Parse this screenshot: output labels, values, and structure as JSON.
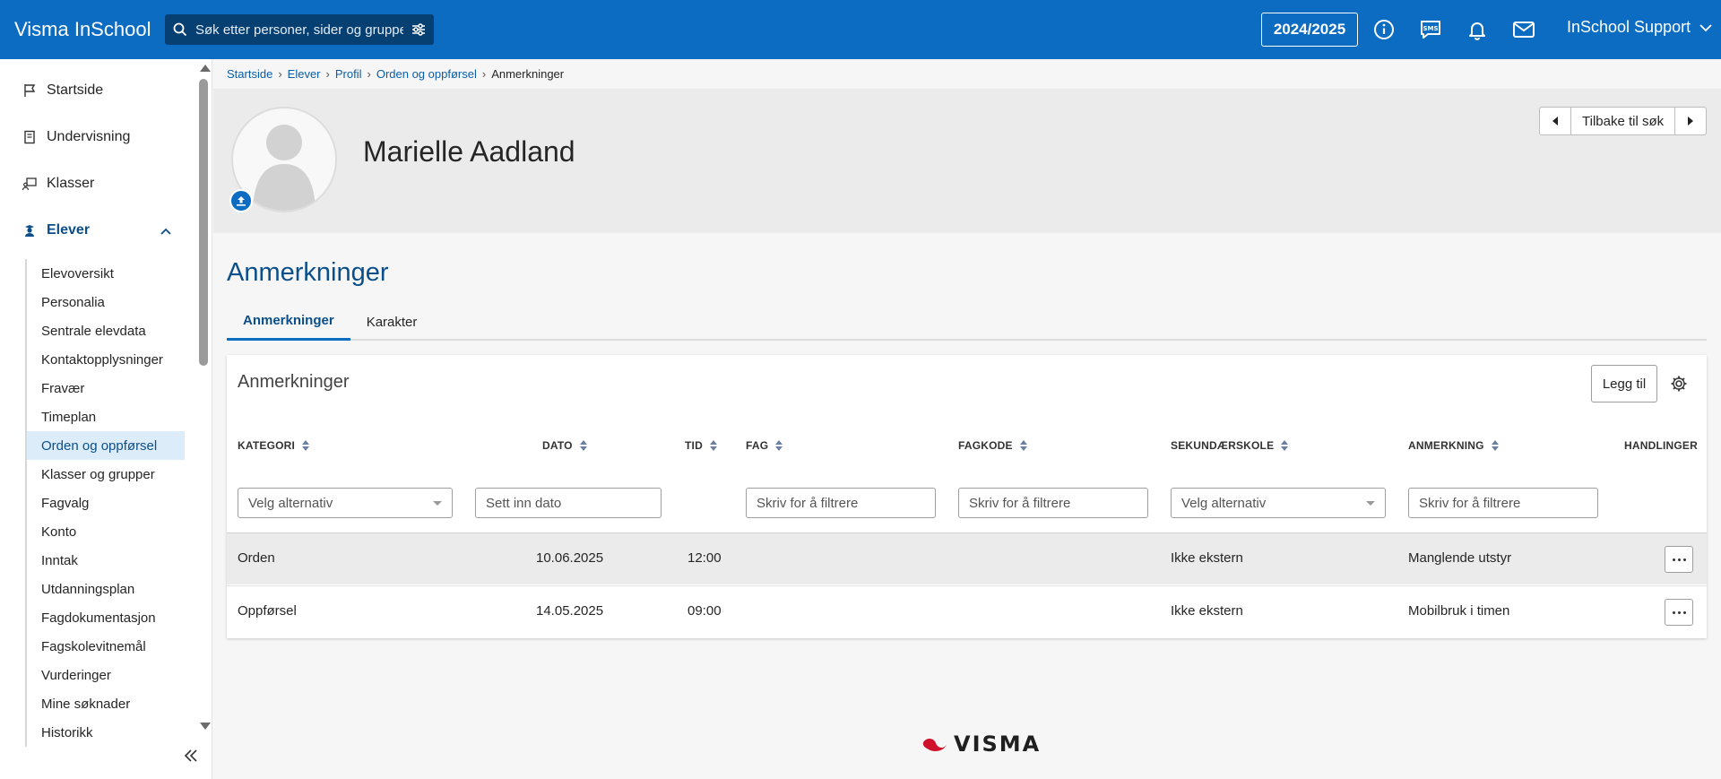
{
  "header": {
    "brand": "Visma InSchool",
    "search_placeholder": "Søk etter personer, sider og grupper",
    "year": "2024/2025",
    "user": "InSchool Support",
    "colors": {
      "bar": "#0b6cc2",
      "search_bg": "#063f72"
    }
  },
  "sidebar": {
    "top_items": [
      {
        "label": "Startside",
        "icon": "flag-icon"
      },
      {
        "label": "Undervisning",
        "icon": "book-icon"
      },
      {
        "label": "Klasser",
        "icon": "classroom-icon"
      },
      {
        "label": "Elever",
        "icon": "student-icon"
      }
    ],
    "sub_items": [
      "Elevoversikt",
      "Personalia",
      "Sentrale elevdata",
      "Kontaktopplysninger",
      "Fravær",
      "Timeplan",
      "Orden og oppførsel",
      "Klasser og grupper",
      "Fagvalg",
      "Konto",
      "Inntak",
      "Utdanningsplan",
      "Fagdokumentasjon",
      "Fagskolevitnemål",
      "Vurderinger",
      "Mine søknader",
      "Historikk"
    ],
    "selected_sub_item": "Orden og oppførsel"
  },
  "breadcrumb": {
    "items": [
      "Startside",
      "Elever",
      "Profil",
      "Orden og oppførsel"
    ],
    "current": "Anmerkninger"
  },
  "profile": {
    "name": "Marielle Aadland",
    "back_label": "Tilbake til søk"
  },
  "page": {
    "title": "Anmerkninger",
    "tabs": [
      "Anmerkninger",
      "Karakter"
    ],
    "active_tab": "Anmerkninger"
  },
  "card": {
    "title": "Anmerkninger",
    "add_label": "Legg til"
  },
  "table": {
    "columns": [
      "KATEGORI",
      "DATO",
      "TID",
      "FAG",
      "FAGKODE",
      "SEKUNDÆRSKOLE",
      "ANMERKNING",
      "HANDLINGER"
    ],
    "filters": {
      "kategori": "Velg alternativ",
      "dato": "Sett inn dato",
      "fag": "Skriv for å filtrere",
      "fagkode": "Skriv for å filtrere",
      "sekundaerskole": "Velg alternativ",
      "anmerkning": "Skriv for å filtrere"
    },
    "rows": [
      {
        "kategori": "Orden",
        "dato": "10.06.2025",
        "tid": "12:00",
        "fag": "",
        "fagkode": "",
        "sekundaerskole": "Ikke ekstern",
        "anmerkning": "Manglende utstyr"
      },
      {
        "kategori": "Oppførsel",
        "dato": "14.05.2025",
        "tid": "09:00",
        "fag": "",
        "fagkode": "",
        "sekundaerskole": "Ikke ekstern",
        "anmerkning": "Mobilbruk i timen"
      }
    ]
  },
  "footer": {
    "logo_text": "VISMA"
  }
}
